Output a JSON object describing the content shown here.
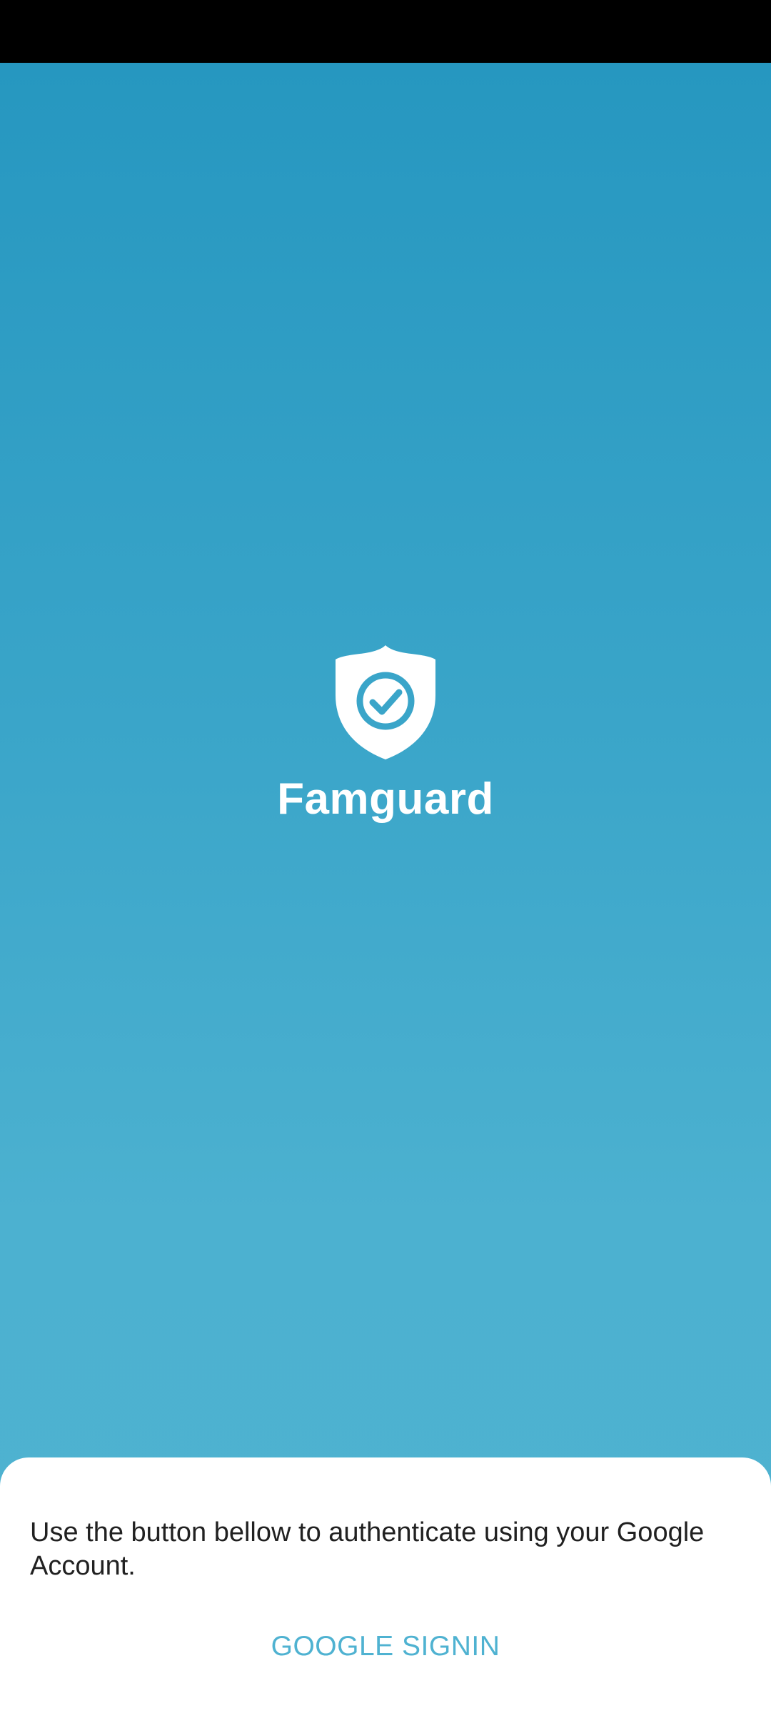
{
  "app": {
    "title": "Famguard",
    "logo_icon": "shield-check-icon"
  },
  "colors": {
    "gradient_top": "#2697c0",
    "gradient_bottom": "#4fb2d1",
    "accent": "#4fb2d1",
    "sheet_background": "#ffffff",
    "text_primary": "#212121"
  },
  "auth_sheet": {
    "message": "Use the button bellow to authenticate using your Google Account.",
    "signin_label": "GOOGLE SIGNIN"
  }
}
